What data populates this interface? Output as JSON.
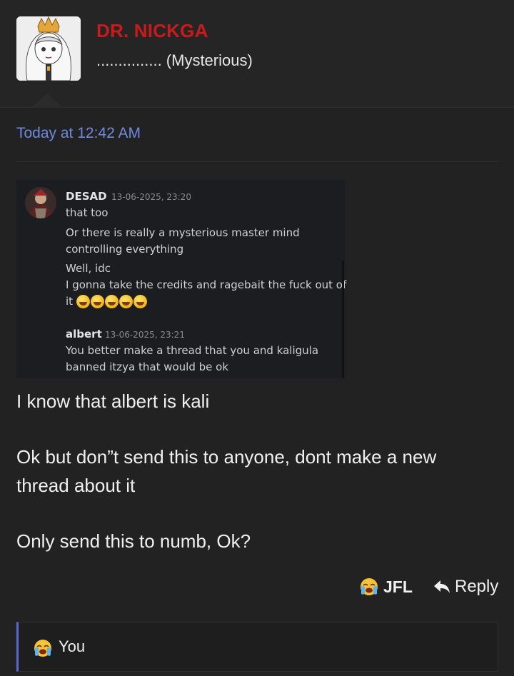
{
  "post": {
    "author": "DR. NICKGA",
    "author_title": "............... (Mysterious)",
    "timestamp": "Today at 12:42 AM",
    "embedded_screenshot": {
      "messages": [
        {
          "user": "DESAD",
          "time": "13-06-2025, 23:20",
          "lines": [
            "that too",
            "Or there is really a mysterious master mind",
            "controlling everything",
            "Well, idc",
            "I gonna take the credits and ragebait the fuck out of",
            "it"
          ],
          "emoji": [
            "rolling-on-floor-laughing",
            "rolling-on-floor-laughing",
            "rolling-on-floor-laughing",
            "rolling-on-floor-laughing",
            "rolling-on-floor-laughing"
          ]
        },
        {
          "user": "albert",
          "time": "13-06-2025, 23:21",
          "lines": [
            "You better make a thread that you and kaligula",
            "banned itzya that would be ok"
          ]
        }
      ]
    },
    "body": {
      "p1": "I know that albert is kali",
      "p2_line1": "Ok but don”t send this to anyone, dont make a new",
      "p2_line2": "thread about it",
      "p3": "Only send this to numb, Ok?"
    },
    "actions": {
      "reaction_label": "JFL",
      "reaction_icon": "loudly-crying-face-icon",
      "reply_label": "Reply",
      "reply_icon": "reply-arrow-icon"
    },
    "reactions_bar": {
      "icon": "loudly-crying-face-icon",
      "label": "You"
    }
  },
  "colors": {
    "background": "#222222",
    "author": "#c81b1b",
    "timestamp": "#6f8ae0",
    "quote_accent": "#5a6ad0"
  }
}
